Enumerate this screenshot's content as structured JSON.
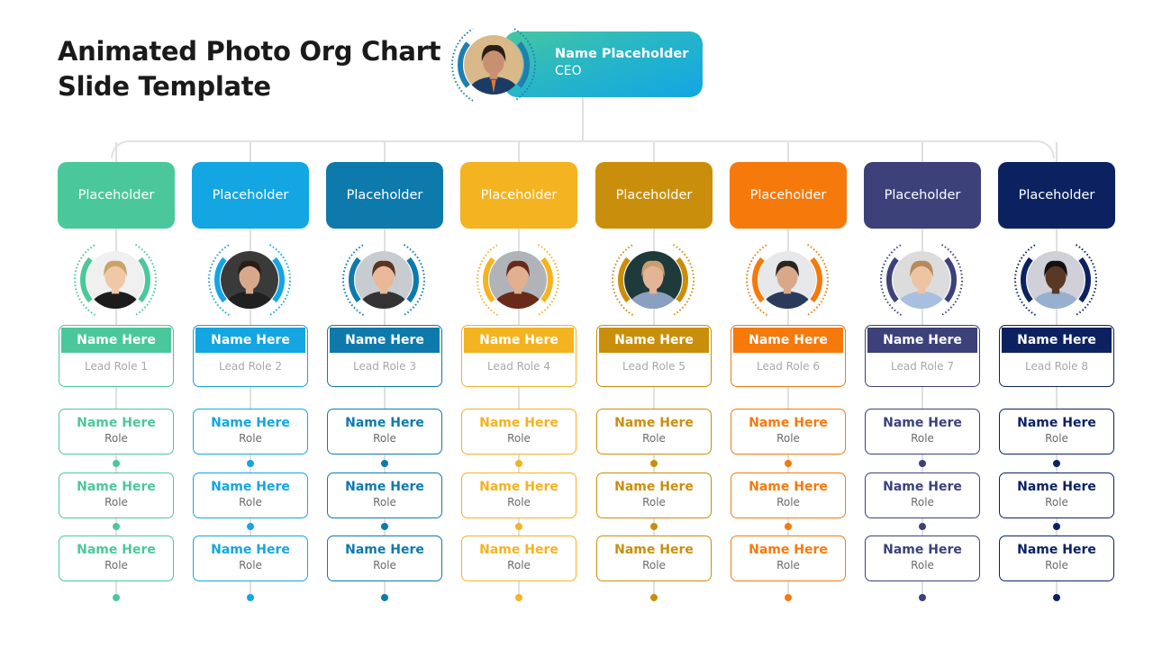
{
  "title": {
    "line1": "Animated Photo Org Chart",
    "line2": "Slide Template"
  },
  "ceo": {
    "name": "Name Placeholder",
    "role": "CEO",
    "photo": "ceo-photo-icon",
    "colors": {
      "ring": "#1f7fb0",
      "skin": "#c89070",
      "bg": "#d9b88a",
      "suit": "#1b3b66",
      "accent": "#e8782a"
    }
  },
  "departments": [
    {
      "label": "Placeholder",
      "color": "#4bc89b",
      "lead_name": "Name Here",
      "lead_role": "Lead Role 1",
      "photo": {
        "bg": "#f0f0f0",
        "hair": "#c9a46a",
        "skin": "#f0c8a8",
        "shirt": "#1c1c1c"
      },
      "members": [
        {
          "name": "Name Here",
          "role": "Role"
        },
        {
          "name": "Name Here",
          "role": "Role"
        },
        {
          "name": "Name Here",
          "role": "Role"
        }
      ]
    },
    {
      "label": "Placeholder",
      "color": "#13a6e2",
      "lead_name": "Name Here",
      "lead_role": "Lead Role 2",
      "photo": {
        "bg": "#3a3a3a",
        "hair": "#2a1d16",
        "skin": "#d8a88a",
        "shirt": "#202020"
      },
      "members": [
        {
          "name": "Name Here",
          "role": "Role"
        },
        {
          "name": "Name Here",
          "role": "Role"
        },
        {
          "name": "Name Here",
          "role": "Role"
        }
      ]
    },
    {
      "label": "Placeholder",
      "color": "#0e7aab",
      "lead_name": "Name Here",
      "lead_role": "Lead Role 3",
      "photo": {
        "bg": "#c8ccd0",
        "hair": "#5a3422",
        "skin": "#e8b898",
        "shirt": "#333333"
      },
      "members": [
        {
          "name": "Name Here",
          "role": "Role"
        },
        {
          "name": "Name Here",
          "role": "Role"
        },
        {
          "name": "Name Here",
          "role": "Role"
        }
      ]
    },
    {
      "label": "Placeholder",
      "color": "#f4b320",
      "lead_name": "Name Here",
      "lead_role": "Lead Role 4",
      "photo": {
        "bg": "#b0b4b8",
        "hair": "#6a2a1a",
        "skin": "#e0b090",
        "shirt": "#6a2a1a"
      },
      "members": [
        {
          "name": "Name Here",
          "role": "Role"
        },
        {
          "name": "Name Here",
          "role": "Role"
        },
        {
          "name": "Name Here",
          "role": "Role"
        }
      ]
    },
    {
      "label": "Placeholder",
      "color": "#c98f0c",
      "lead_name": "Name Here",
      "lead_role": "Lead Role 5",
      "photo": {
        "bg": "#1e3a3a",
        "hair": "#c8a070",
        "skin": "#e4b496",
        "shirt": "#8aa0c0"
      },
      "members": [
        {
          "name": "Name Here",
          "role": "Role"
        },
        {
          "name": "Name Here",
          "role": "Role"
        },
        {
          "name": "Name Here",
          "role": "Role"
        }
      ]
    },
    {
      "label": "Placeholder",
      "color": "#f6790c",
      "lead_name": "Name Here",
      "lead_role": "Lead Role 6",
      "photo": {
        "bg": "#e6e8ea",
        "hair": "#2a2420",
        "skin": "#d8a888",
        "shirt": "#2a3a5a"
      },
      "members": [
        {
          "name": "Name Here",
          "role": "Role"
        },
        {
          "name": "Name Here",
          "role": "Role"
        },
        {
          "name": "Name Here",
          "role": "Role"
        }
      ]
    },
    {
      "label": "Placeholder",
      "color": "#3c417a",
      "lead_name": "Name Here",
      "lead_role": "Lead Role 7",
      "photo": {
        "bg": "#dcdcdc",
        "hair": "#b88a5a",
        "skin": "#ecc4a4",
        "shirt": "#a8c0e0"
      },
      "members": [
        {
          "name": "Name Here",
          "role": "Role"
        },
        {
          "name": "Name Here",
          "role": "Role"
        },
        {
          "name": "Name Here",
          "role": "Role"
        }
      ]
    },
    {
      "label": "Placeholder",
      "color": "#0c2260",
      "lead_name": "Name Here",
      "lead_role": "Lead Role 8",
      "photo": {
        "bg": "#d0d0d8",
        "hair": "#111111",
        "skin": "#5a3826",
        "shirt": "#98b0d0"
      },
      "members": [
        {
          "name": "Name Here",
          "role": "Role"
        },
        {
          "name": "Name Here",
          "role": "Role"
        },
        {
          "name": "Name Here",
          "role": "Role"
        }
      ]
    }
  ]
}
